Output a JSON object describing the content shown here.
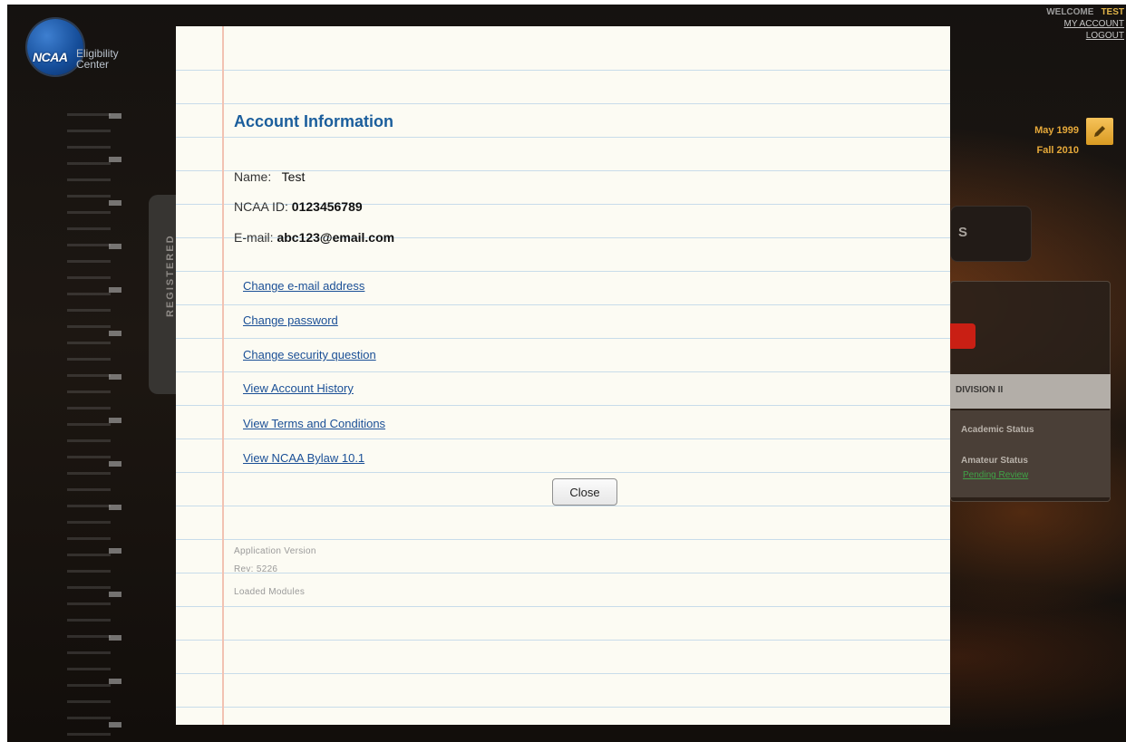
{
  "header": {
    "logo_text": "NCAA",
    "logo_subtitle": "Eligibility Center",
    "welcome_label": "WELCOME",
    "user_name": "TEST",
    "my_account": "MY ACCOUNT",
    "logout": "LOGOUT"
  },
  "dates": {
    "birth": "May 1999",
    "enroll": "Fall 2010"
  },
  "background": {
    "registered_label": "REGISTERED",
    "box_fragment": "S",
    "division_label": "DIVISION II",
    "academic_status": "Academic Status",
    "amateur_status": "Amateur Status",
    "pending_review": "Pending Review"
  },
  "modal": {
    "title": "Account Information",
    "name_label": "Name:",
    "name_value": "Test",
    "id_label": "NCAA ID:",
    "id_value": "0123456789",
    "email_label": "E-mail:",
    "email_value": "abc123@email.com",
    "links": [
      "Change e-mail address",
      "Change password",
      "Change security question",
      "View Account History",
      "View Terms and Conditions",
      "View NCAA Bylaw 10.1"
    ],
    "close_label": "Close",
    "version_lines": [
      "Application Version",
      "Rev: 5226",
      "Loaded Modules"
    ]
  },
  "colors": {
    "title_blue": "#1b5e9c",
    "link_blue": "#1a4f96",
    "paper": "#fcfbf3",
    "rule_line": "#c8dcea",
    "margin_line": "#f2c2b2",
    "accent_gold": "#e6a93a"
  }
}
